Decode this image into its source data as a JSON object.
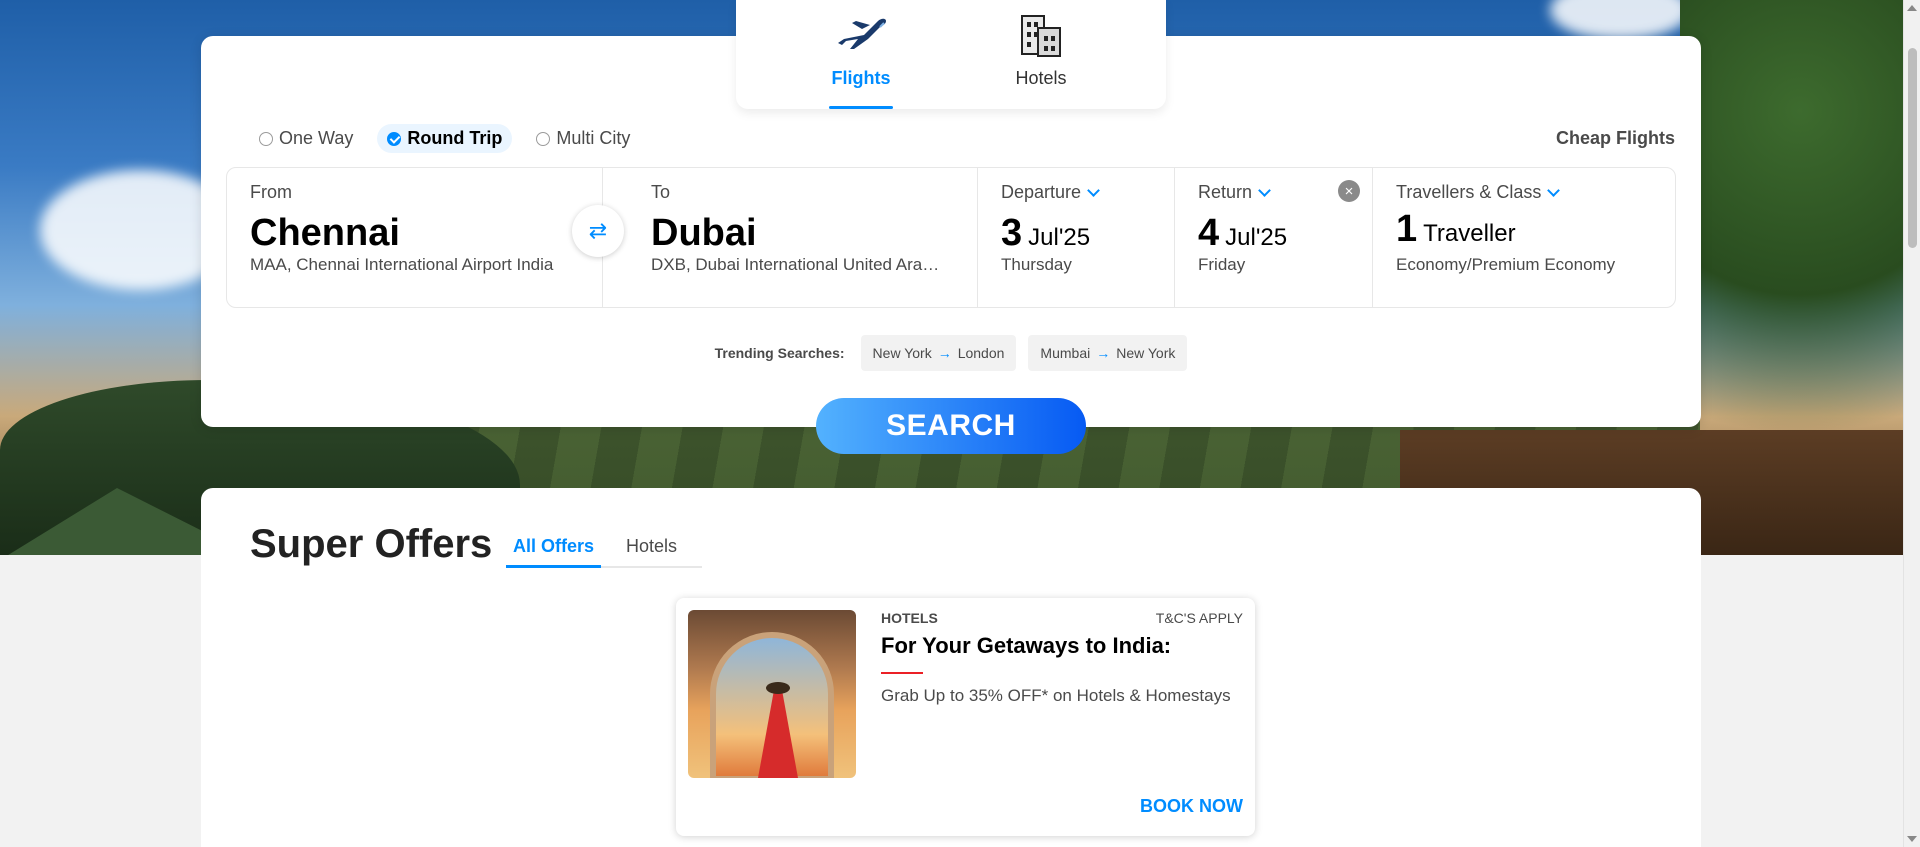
{
  "product_tabs": [
    {
      "label": "Flights",
      "icon": "airplane-icon",
      "active": true
    },
    {
      "label": "Hotels",
      "icon": "hotel-building-icon",
      "active": false
    }
  ],
  "trip_types": [
    {
      "label": "One Way",
      "active": false
    },
    {
      "label": "Round Trip",
      "active": true
    },
    {
      "label": "Multi City",
      "active": false
    }
  ],
  "cheap_flights": "Cheap Flights",
  "from": {
    "label": "From",
    "city": "Chennai",
    "airport": "MAA, Chennai International Airport India"
  },
  "to": {
    "label": "To",
    "city": "Dubai",
    "airport": "DXB, Dubai International United Ara…"
  },
  "departure": {
    "label": "Departure",
    "day": "3",
    "month": "Jul'25",
    "weekday": "Thursday"
  },
  "return": {
    "label": "Return",
    "day": "4",
    "month": "Jul'25",
    "weekday": "Friday"
  },
  "travellers": {
    "label": "Travellers & Class",
    "count": "1",
    "word": "Traveller",
    "class": "Economy/Premium Economy"
  },
  "trending": {
    "label": "Trending Searches:",
    "items": [
      {
        "from": "New York",
        "to": "London"
      },
      {
        "from": "Mumbai",
        "to": "New York"
      }
    ]
  },
  "search_label": "SEARCH",
  "offers": {
    "title": "Super Offers",
    "tabs": [
      {
        "label": "All Offers",
        "active": true
      },
      {
        "label": "Hotels",
        "active": false
      }
    ],
    "card": {
      "category": "HOTELS",
      "tc": "T&C'S APPLY",
      "title": "For Your Getaways to India:",
      "desc": "Grab Up to 35% OFF* on Hotels & Homestays",
      "cta": "BOOK NOW"
    }
  },
  "colors": {
    "accent": "#008cff",
    "search_start": "#53b2fe",
    "search_end": "#065af3",
    "offer_line": "#eb2026"
  }
}
